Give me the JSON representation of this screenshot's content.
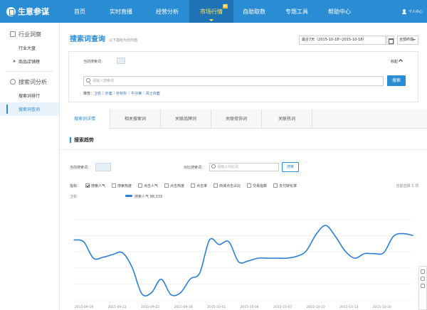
{
  "logo": "生意参谋",
  "nav": [
    {
      "label": "首页",
      "active": false
    },
    {
      "label": "实时直播",
      "active": false
    },
    {
      "label": "经营分析",
      "active": false
    },
    {
      "label": "市场行情",
      "active": true,
      "badge": "新"
    },
    {
      "label": "自助取数",
      "active": false
    },
    {
      "label": "专题工具",
      "active": false
    },
    {
      "label": "帮助中心",
      "active": false
    }
  ],
  "user": "个人中心",
  "sidebar": {
    "group1": "行业洞察",
    "group1_items": [
      "行业大盘",
      "商品店铺榜"
    ],
    "group2": "搜索词分析",
    "group2_items": [
      "搜索词排行",
      "搜索词查询"
    ]
  },
  "page": {
    "title": "搜索词查询",
    "subtitle": "以下指标为日均值",
    "date_range": "最近7天（2015-10-18~2015-10-18）",
    "terminal": "全部终端"
  },
  "filter": {
    "current_label": "当前搜索词：",
    "collapse": "收起",
    "search_placeholder": "请输入搜索词",
    "search_button": "搜索",
    "suggest_label": "推荐：",
    "suggest_words": [
      "卫衣",
      "外套",
      "针织衫",
      "牛仔裤",
      "风士外套"
    ]
  },
  "tabs": [
    "搜索词详情",
    "相关搜索词",
    "关联品牌词",
    "关联修饰词",
    "关联热词"
  ],
  "section_title": "搜索趋势",
  "compare": {
    "current_label": "当前搜索词：",
    "compare_label": "对比搜索词：",
    "placeholder": "请输入对比词",
    "button": "搜索"
  },
  "metrics": {
    "label": "指标：",
    "items": [
      {
        "label": "搜索人气",
        "checked": true
      },
      {
        "label": "搜索热度",
        "checked": false
      },
      {
        "label": "点击人气",
        "checked": false
      },
      {
        "label": "点击热度",
        "checked": false
      },
      {
        "label": "点击率",
        "checked": false
      },
      {
        "label": "商城点击占比",
        "checked": false
      },
      {
        "label": "交易指数",
        "checked": false
      },
      {
        "label": "支付转化率",
        "checked": false
      }
    ],
    "limit_prefix": "还能选择",
    "limit_count": "1",
    "limit_suffix": "项"
  },
  "chart_data": {
    "type": "line",
    "title": "",
    "xlabel": "",
    "ylabel": "卫衣",
    "legend": "top-center",
    "grid": true,
    "series": [
      {
        "name": "搜索人气",
        "legend_value": "98,333",
        "color": "#2a7fd4",
        "values": [
          66,
          64,
          46,
          47,
          50,
          52,
          36,
          7,
          8,
          23,
          6,
          8,
          23,
          30,
          66,
          61,
          64,
          42,
          43,
          46,
          46,
          46,
          46,
          48,
          54,
          72,
          82,
          70,
          54,
          46,
          51,
          51,
          52,
          70,
          73,
          71
        ]
      }
    ],
    "x_tick_labels": [
      "2015-09-19",
      "2015-09-22",
      "2015-09-25",
      "2015-09-28",
      "2015-10-01",
      "2015-10-04",
      "2015-10-07",
      "2015-10-10",
      "2015-10-13",
      "2015-10-16"
    ],
    "ylim": [
      0,
      100
    ]
  }
}
